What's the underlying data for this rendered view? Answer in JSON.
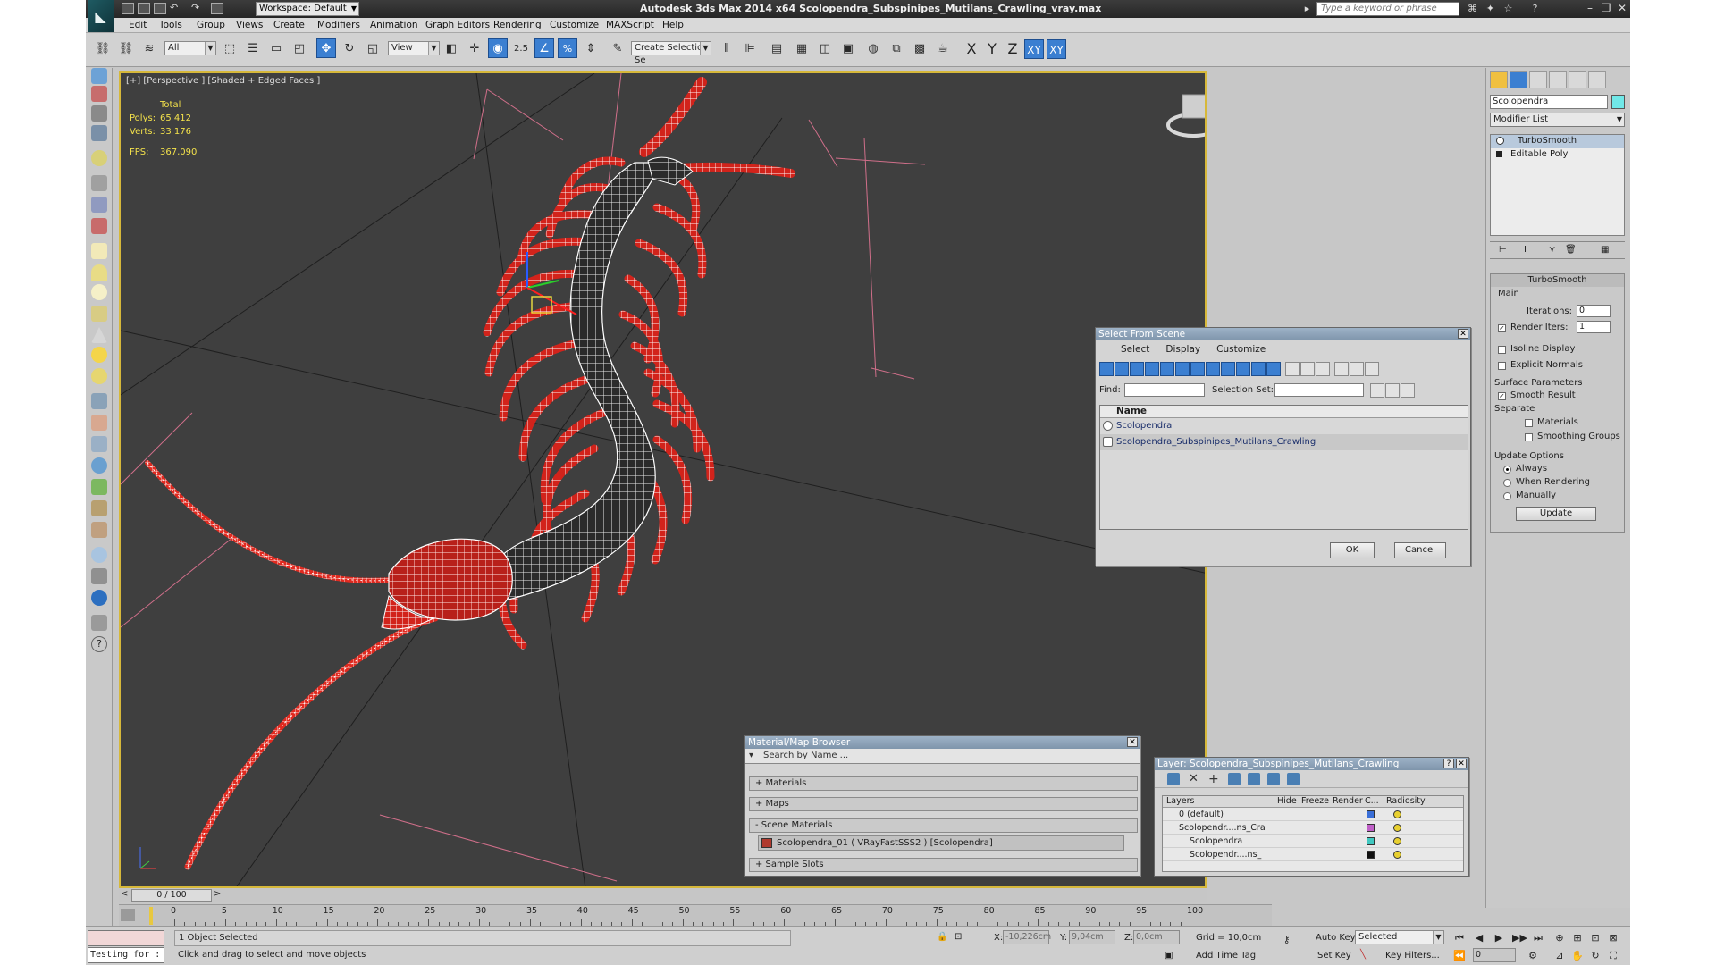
{
  "app": {
    "window_title": "Autodesk 3ds Max  2014 x64     Scolopendra_Subspinipes_Mutilans_Crawling_vray.max",
    "workspace": "Workspace: Default",
    "search_placeholder": "Type a keyword or phrase",
    "menu": [
      "Edit",
      "Tools",
      "Group",
      "Views",
      "Create",
      "Modifiers",
      "Animation",
      "Graph Editors",
      "Rendering",
      "Customize",
      "MAXScript",
      "Help"
    ]
  },
  "toolbar": {
    "selection_filter": "All",
    "ref_coord": "View",
    "snap_value": "2.5",
    "named_selection": "Create Selection Se",
    "axis": [
      "X",
      "Y",
      "Z",
      "XY",
      "XY"
    ]
  },
  "viewport": {
    "label": "[+] [Perspective ] [Shaded + Edged Faces ]",
    "stats_header": "Total",
    "stats": [
      {
        "key": "Polys:",
        "value": "65 412"
      },
      {
        "key": "Verts:",
        "value": "33 176"
      }
    ],
    "fps_key": "FPS:",
    "fps_value": "367,090",
    "colors": {
      "background": "#3f3f3f",
      "wire": "#ffffff",
      "shell": "#2c2c2c",
      "legs": "#d9261c",
      "grid": "#d06f8a"
    }
  },
  "select_from_scene": {
    "title": "Select From Scene",
    "menus": [
      "Select",
      "Display",
      "Customize"
    ],
    "find_label": "Find:",
    "selection_set_label": "Selection Set:",
    "column_name": "Name",
    "items": [
      "Scolopendra",
      "Scolopendra_Subspinipes_Mutilans_Crawling"
    ],
    "ok": "OK",
    "cancel": "Cancel"
  },
  "material_browser": {
    "title": "Material/Map Browser",
    "search": "Search by Name ...",
    "sections": [
      "+ Materials",
      "+ Maps",
      "- Scene Materials",
      "+ Sample Slots"
    ],
    "scene_material": "Scolopendra_01  ( VRayFastSSS2 )  [Scolopendra]"
  },
  "layer_dialog": {
    "title": "Layer: Scolopendra_Subspinipes_Mutilans_Crawling",
    "help": "?",
    "columns": [
      "Layers",
      "Hide",
      "Freeze",
      "Render",
      "C...",
      "Radiosity"
    ],
    "rows": [
      {
        "name": "0 (default)",
        "color": "#3a6fd8"
      },
      {
        "name": "Scolopendr....ns_Cra",
        "color": "#c060c8"
      },
      {
        "name": "Scolopendra",
        "color": "#40c8c0"
      },
      {
        "name": "Scolopendr....ns_",
        "color": "#101010"
      }
    ]
  },
  "command_panel": {
    "object_name": "Scolopendra",
    "object_color": "#70e8e8",
    "modifier_list": "Modifier List",
    "stack": [
      "TurboSmooth",
      "Editable Poly"
    ],
    "turbosmooth": {
      "title": "TurboSmooth",
      "main": "Main",
      "iterations_label": "Iterations:",
      "iterations": "0",
      "render_iters_label": "Render Iters:",
      "render_iters": "1",
      "isoline": "Isoline Display",
      "explicit": "Explicit Normals",
      "surface_params": "Surface Parameters",
      "smooth_result": "Smooth Result",
      "separate": "Separate",
      "materials": "Materials",
      "smoothing_groups": "Smoothing Groups",
      "update_options": "Update Options",
      "always": "Always",
      "when_rendering": "When Rendering",
      "manually": "Manually",
      "update": "Update"
    }
  },
  "timeline": {
    "frame": "0 / 100",
    "ticks": [
      "0",
      "5",
      "10",
      "15",
      "20",
      "25",
      "30",
      "35",
      "40",
      "45",
      "50",
      "55",
      "60",
      "65",
      "70",
      "75",
      "80",
      "85",
      "90",
      "95",
      "100"
    ]
  },
  "status": {
    "maxscript": "Testing for :",
    "selection": "1 Object Selected",
    "prompt": "Click and drag to select and move objects",
    "x_label": "X:",
    "x_value": "-10,226cm",
    "y_label": "Y:",
    "y_value": "9,04cm",
    "z_label": "Z:",
    "z_value": "0,0cm",
    "grid": "Grid = 10,0cm",
    "add_time_tag": "Add Time Tag",
    "auto_key": "Auto Key",
    "selected": "Selected",
    "set_key": "Set Key",
    "key_filters": "Key Filters...",
    "current_frame": "0"
  }
}
